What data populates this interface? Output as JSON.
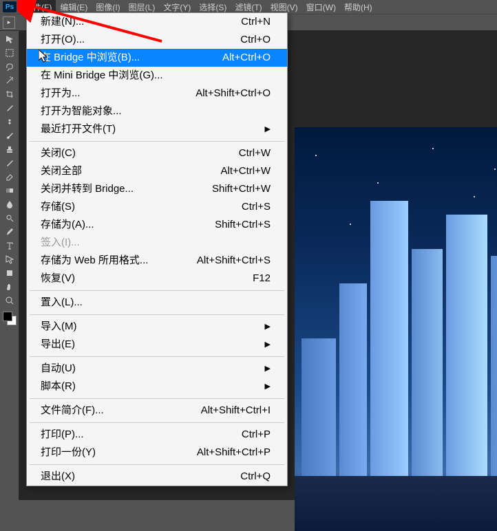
{
  "menubar": {
    "items": [
      "文件(F)",
      "编辑(E)",
      "图像(I)",
      "图层(L)",
      "文字(Y)",
      "选择(S)",
      "滤镜(T)",
      "视图(V)",
      "窗口(W)",
      "帮助(H)"
    ]
  },
  "dropdown": {
    "groups": [
      [
        {
          "label": "新建(N)...",
          "shortcut": "Ctrl+N",
          "submenu": false,
          "highlighted": false,
          "disabled": false
        },
        {
          "label": "打开(O)...",
          "shortcut": "Ctrl+O",
          "submenu": false,
          "highlighted": false,
          "disabled": false
        },
        {
          "label": "在 Bridge 中浏览(B)...",
          "shortcut": "Alt+Ctrl+O",
          "submenu": false,
          "highlighted": true,
          "disabled": false
        },
        {
          "label": "在 Mini Bridge 中浏览(G)...",
          "shortcut": "",
          "submenu": false,
          "highlighted": false,
          "disabled": false
        },
        {
          "label": "打开为...",
          "shortcut": "Alt+Shift+Ctrl+O",
          "submenu": false,
          "highlighted": false,
          "disabled": false
        },
        {
          "label": "打开为智能对象...",
          "shortcut": "",
          "submenu": false,
          "highlighted": false,
          "disabled": false
        },
        {
          "label": "最近打开文件(T)",
          "shortcut": "",
          "submenu": true,
          "highlighted": false,
          "disabled": false
        }
      ],
      [
        {
          "label": "关闭(C)",
          "shortcut": "Ctrl+W",
          "submenu": false,
          "highlighted": false,
          "disabled": false
        },
        {
          "label": "关闭全部",
          "shortcut": "Alt+Ctrl+W",
          "submenu": false,
          "highlighted": false,
          "disabled": false
        },
        {
          "label": "关闭并转到 Bridge...",
          "shortcut": "Shift+Ctrl+W",
          "submenu": false,
          "highlighted": false,
          "disabled": false
        },
        {
          "label": "存储(S)",
          "shortcut": "Ctrl+S",
          "submenu": false,
          "highlighted": false,
          "disabled": false
        },
        {
          "label": "存储为(A)...",
          "shortcut": "Shift+Ctrl+S",
          "submenu": false,
          "highlighted": false,
          "disabled": false
        },
        {
          "label": "签入(I)...",
          "shortcut": "",
          "submenu": false,
          "highlighted": false,
          "disabled": true
        },
        {
          "label": "存储为 Web 所用格式...",
          "shortcut": "Alt+Shift+Ctrl+S",
          "submenu": false,
          "highlighted": false,
          "disabled": false
        },
        {
          "label": "恢复(V)",
          "shortcut": "F12",
          "submenu": false,
          "highlighted": false,
          "disabled": false
        }
      ],
      [
        {
          "label": "置入(L)...",
          "shortcut": "",
          "submenu": false,
          "highlighted": false,
          "disabled": false
        }
      ],
      [
        {
          "label": "导入(M)",
          "shortcut": "",
          "submenu": true,
          "highlighted": false,
          "disabled": false
        },
        {
          "label": "导出(E)",
          "shortcut": "",
          "submenu": true,
          "highlighted": false,
          "disabled": false
        }
      ],
      [
        {
          "label": "自动(U)",
          "shortcut": "",
          "submenu": true,
          "highlighted": false,
          "disabled": false
        },
        {
          "label": "脚本(R)",
          "shortcut": "",
          "submenu": true,
          "highlighted": false,
          "disabled": false
        }
      ],
      [
        {
          "label": "文件简介(F)...",
          "shortcut": "Alt+Shift+Ctrl+I",
          "submenu": false,
          "highlighted": false,
          "disabled": false
        }
      ],
      [
        {
          "label": "打印(P)...",
          "shortcut": "Ctrl+P",
          "submenu": false,
          "highlighted": false,
          "disabled": false
        },
        {
          "label": "打印一份(Y)",
          "shortcut": "Alt+Shift+Ctrl+P",
          "submenu": false,
          "highlighted": false,
          "disabled": false
        }
      ],
      [
        {
          "label": "退出(X)",
          "shortcut": "Ctrl+Q",
          "submenu": false,
          "highlighted": false,
          "disabled": false
        }
      ]
    ]
  },
  "tools": [
    "move",
    "marquee",
    "lasso",
    "wand",
    "crop",
    "eyedropper",
    "heal",
    "brush",
    "stamp",
    "history",
    "eraser",
    "gradient",
    "blur",
    "dodge",
    "pen",
    "type",
    "path",
    "shape",
    "hand",
    "zoom"
  ]
}
